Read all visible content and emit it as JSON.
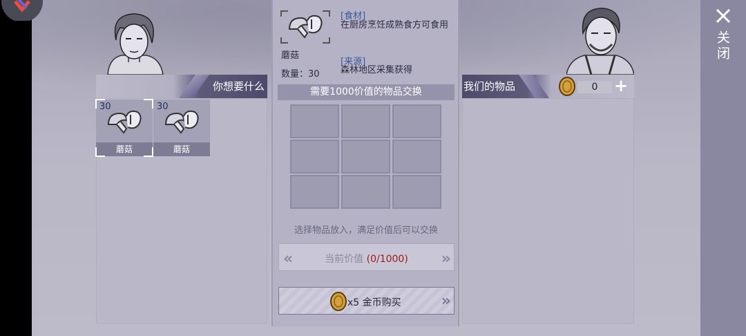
{
  "close": {
    "label": "关闭",
    "icon": "close-icon"
  },
  "left": {
    "header": "你想要什么"
  },
  "items": [
    {
      "count": "30",
      "name": "蘑菇",
      "icon": "mushroom-icon",
      "selected": true
    },
    {
      "count": "30",
      "name": "蘑菇",
      "icon": "mushroom-icon",
      "selected": false
    }
  ],
  "detail": {
    "name": "蘑菇",
    "quantity": "数量：30",
    "category_tag": "[食材]",
    "category_text": "在厨房烹饪成熟食方可食用",
    "source_tag": "[来源]",
    "source_text": "森林地区采集获得"
  },
  "exchange": {
    "title": "需要1000价值的物品交换",
    "hint": "选择物品放入，满足价值后可以交换",
    "value_label": "当前价值",
    "value_progress": "(0/1000)",
    "prev_arrows": "«",
    "next_arrows": "»"
  },
  "buy": {
    "label": "x5 金币购买",
    "arrows": "»"
  },
  "right": {
    "header": "我们的物品",
    "coins": "0",
    "add": "+"
  },
  "colors": {
    "accent_dark": "#4c496a",
    "value_red": "#a01818",
    "tag_blue": "#3a5a9a",
    "coin_gold": "#d4a23a"
  }
}
